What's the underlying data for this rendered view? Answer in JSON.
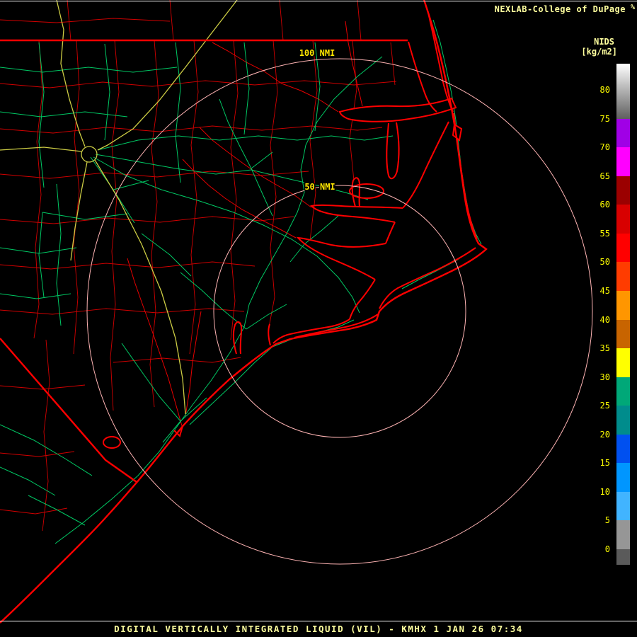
{
  "header": {
    "title": "NEXLAB-College of DuPage",
    "title_mark": "%",
    "product_label": "NIDS",
    "units_label": "[kg/m2]"
  },
  "footer": {
    "caption": "DIGITAL VERTICALLY INTEGRATED LIQUID (VIL) - KMHX 1 JAN 26 07:34"
  },
  "map": {
    "range_rings": [
      {
        "label": "50 NMI",
        "radius_nmi": 50
      },
      {
        "label": "100 NMI",
        "radius_nmi": 100
      }
    ]
  },
  "colorbar": {
    "units": "kg/m2",
    "ticks": [
      "80",
      "75",
      "70",
      "65",
      "60",
      "55",
      "50",
      "45",
      "40",
      "35",
      "30",
      "25",
      "20",
      "15",
      "10",
      "5",
      "0"
    ],
    "top_gradient": [
      "#ffffff",
      "#5f5f5f"
    ],
    "under_color": "#5a5a5a",
    "bands": [
      {
        "v": 70,
        "color": "#a000e6"
      },
      {
        "v": 65,
        "color": "#ff00ff"
      },
      {
        "v": 60,
        "color": "#9b0000"
      },
      {
        "v": 55,
        "color": "#d80000"
      },
      {
        "v": 50,
        "color": "#ff0000"
      },
      {
        "v": 45,
        "color": "#ff3c00"
      },
      {
        "v": 40,
        "color": "#ff9600"
      },
      {
        "v": 35,
        "color": "#c86400"
      },
      {
        "v": 30,
        "color": "#ffff00"
      },
      {
        "v": 25,
        "color": "#00a878"
      },
      {
        "v": 20,
        "color": "#008c8c"
      },
      {
        "v": 15,
        "color": "#0050f0"
      },
      {
        "v": 10,
        "color": "#0096ff"
      },
      {
        "v": 5,
        "color": "#41b4ff"
      },
      {
        "v": 0,
        "color": "#969696"
      }
    ]
  },
  "colors": {
    "background": "#000000",
    "coastline_red": "#ff0000",
    "county_red": "#d20000",
    "road_green": "#00c864",
    "road_yellow": "#cccc44",
    "ring_pink": "#ffb4b4",
    "text_yellow": "#ffff9e",
    "tick_yellow": "#ffff00"
  }
}
